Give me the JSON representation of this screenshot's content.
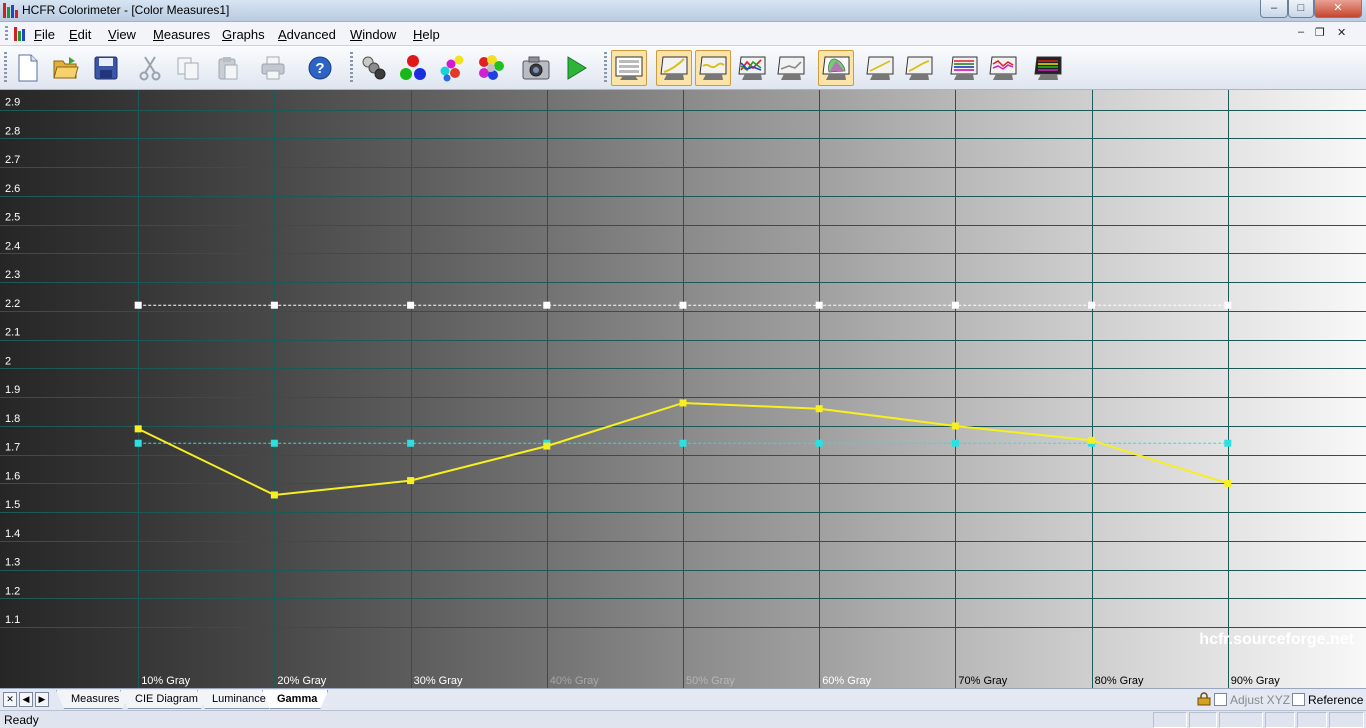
{
  "window": {
    "title": "HCFR Colorimeter - [Color Measures1]",
    "controls": {
      "minimize": "‒",
      "maximize": "□",
      "close": "✕"
    }
  },
  "menu": {
    "items": [
      "File",
      "Edit",
      "View",
      "Measures",
      "Graphs",
      "Advanced",
      "Window",
      "Help"
    ],
    "mdi_controls": {
      "minimize": "‒",
      "restore": "❐",
      "close": "✕"
    }
  },
  "toolbar": {
    "buttons": [
      {
        "name": "new-icon",
        "group": 1
      },
      {
        "name": "open-folder-icon",
        "group": 1
      },
      {
        "name": "save-icon",
        "group": 1
      },
      {
        "name": "cut-icon",
        "group": 1
      },
      {
        "name": "copy-icon",
        "group": 1
      },
      {
        "name": "paste-icon",
        "group": 1
      },
      {
        "name": "print-icon",
        "group": 1
      },
      {
        "name": "help-icon",
        "group": 1
      },
      {
        "name": "gray-scale-measure-icon",
        "group": 2
      },
      {
        "name": "primary-colors-icon",
        "group": 2
      },
      {
        "name": "secondary-colors-icon",
        "group": 2
      },
      {
        "name": "all-colors-icon",
        "group": 2
      },
      {
        "name": "camera-icon",
        "group": 2
      },
      {
        "name": "play-icon",
        "group": 2
      },
      {
        "name": "measures-view-icon",
        "group": 3,
        "pressed": true
      },
      {
        "name": "luminance-graph-icon",
        "group": 3,
        "pressed": true
      },
      {
        "name": "gamma-graph-icon",
        "group": 3,
        "pressed": true
      },
      {
        "name": "rgb-levels-graph-icon",
        "group": 3
      },
      {
        "name": "color-temperature-graph-icon",
        "group": 3
      },
      {
        "name": "cie-diagram-icon",
        "group": 3,
        "pressed": true
      },
      {
        "name": "delta-e-graph-icon",
        "group": 3
      },
      {
        "name": "saturation-luminance-graph-icon",
        "group": 3
      },
      {
        "name": "saturation-shift-graph-icon",
        "group": 3
      },
      {
        "name": "near-black-graph-icon",
        "group": 3
      },
      {
        "name": "reference-graph-icon",
        "group": 3
      }
    ]
  },
  "chart_data": {
    "type": "line",
    "categories": [
      "10% Gray",
      "20% Gray",
      "30% Gray",
      "40% Gray",
      "50% Gray",
      "60% Gray",
      "70% Gray",
      "80% Gray",
      "90% Gray"
    ],
    "series": [
      {
        "color": "#f7ef1f",
        "style": "solid",
        "marker": "square",
        "values": [
          1.79,
          1.56,
          1.61,
          1.73,
          1.88,
          1.86,
          1.8,
          1.75,
          1.6
        ]
      },
      {
        "color": "#ffffff",
        "style": "dashed",
        "marker": "square",
        "values": [
          2.22,
          2.22,
          2.22,
          2.22,
          2.22,
          2.22,
          2.22,
          2.22,
          2.22
        ]
      },
      {
        "color": "#2ae0e0",
        "style": "dashed",
        "marker": "square",
        "values": [
          1.74,
          1.74,
          1.74,
          1.74,
          1.74,
          1.74,
          1.74,
          1.74,
          1.74
        ]
      }
    ],
    "y_ticks": [
      "2.9",
      "2.8",
      "2.7",
      "2.6",
      "2.5",
      "2.4",
      "2.3",
      "2.2",
      "2.1",
      "2",
      "1.9",
      "1.8",
      "1.7",
      "1.6",
      "1.5",
      "1.4",
      "1.3",
      "1.2",
      "1.1"
    ],
    "ylim": [
      1.0,
      2.965
    ],
    "grid": true,
    "background": "grayscale steps 0%–100%",
    "watermark": "hcfr.sourceforge.net",
    "colors": {
      "grid": "#1d5a56",
      "axis_text": "#ffffff",
      "category_text_dark": "#ffffff",
      "category_text_light": "#000000"
    }
  },
  "tabs": {
    "nav": [
      "✕",
      "◀",
      "▶"
    ],
    "items": [
      {
        "label": "Measures",
        "active": false
      },
      {
        "label": "CIE Diagram",
        "active": false
      },
      {
        "label": "Luminance",
        "active": false
      },
      {
        "label": "Gamma",
        "active": true
      }
    ],
    "adjust_xyz": "Adjust XYZ",
    "reference": "Reference"
  },
  "status": {
    "text": "Ready"
  }
}
